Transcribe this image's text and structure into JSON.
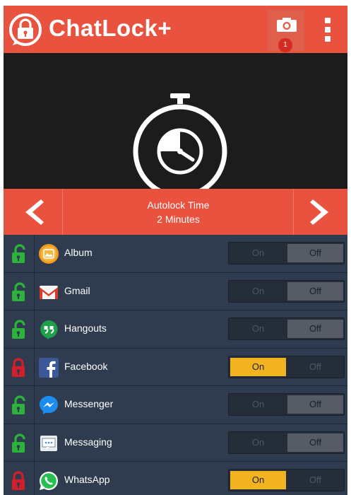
{
  "header": {
    "title": "ChatLock+",
    "camera_badge": "1"
  },
  "autolock": {
    "label": "Autolock Time",
    "value": "2 Minutes"
  },
  "toggle_labels": {
    "on": "On",
    "off": "Off"
  },
  "apps": [
    {
      "name": "Album",
      "locked": false,
      "state": "Off",
      "icon": "album-icon"
    },
    {
      "name": "Gmail",
      "locked": false,
      "state": "Off",
      "icon": "gmail-icon"
    },
    {
      "name": "Hangouts",
      "locked": false,
      "state": "Off",
      "icon": "hangouts-icon"
    },
    {
      "name": "Facebook",
      "locked": true,
      "state": "On",
      "icon": "facebook-icon"
    },
    {
      "name": "Messenger",
      "locked": false,
      "state": "Off",
      "icon": "messenger-icon"
    },
    {
      "name": "Messaging",
      "locked": false,
      "state": "Off",
      "icon": "messaging-icon"
    },
    {
      "name": "WhatsApp",
      "locked": true,
      "state": "On",
      "icon": "whatsapp-icon"
    }
  ],
  "colors": {
    "accent": "#e8523f",
    "unlocked": "#2bb33a",
    "locked": "#d41f2a",
    "toggle_on": "#f2b320"
  }
}
